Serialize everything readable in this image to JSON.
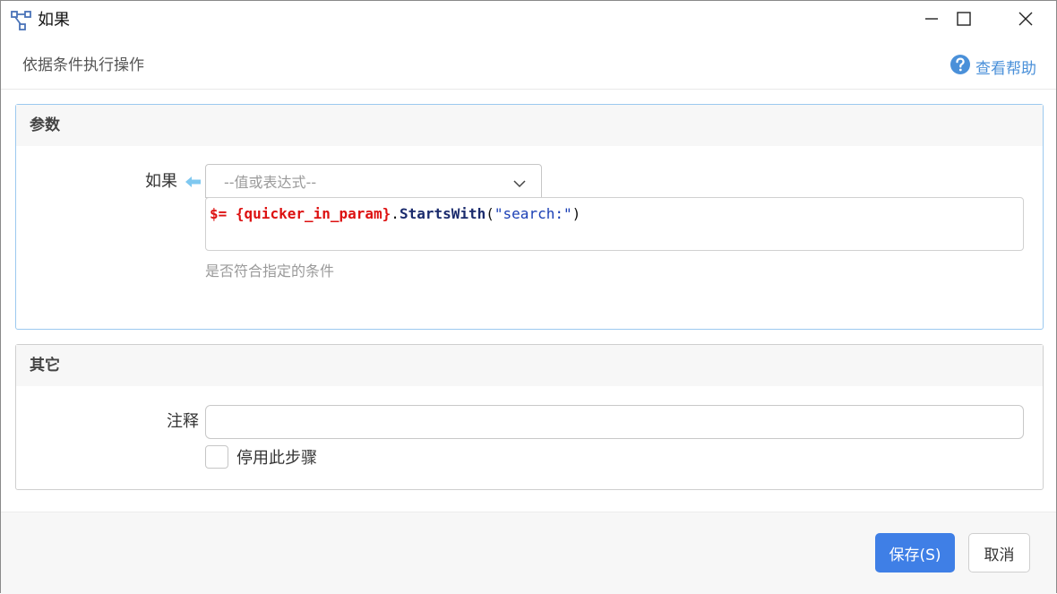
{
  "window": {
    "title": "如果",
    "controls": {
      "minimize": "minimize-icon",
      "maximize": "maximize-icon",
      "close": "close-icon"
    }
  },
  "header": {
    "subtitle": "依据条件执行操作",
    "help_label": "查看帮助"
  },
  "params_panel": {
    "title": "参数",
    "if_field": {
      "label": "如果",
      "select_placeholder": "--值或表达式--",
      "expression": {
        "prefix": "$=",
        "variable": "{quicker_in_param}",
        "dot": ".",
        "method": "StartsWith",
        "open_paren": "(",
        "string": "\"search:\"",
        "close_paren": ")"
      },
      "hint": "是否符合指定的条件"
    }
  },
  "other_panel": {
    "title": "其它",
    "note_label": "注释",
    "note_value": "",
    "disable_label": "停用此步骤",
    "disable_checked": false
  },
  "footer": {
    "save_label": "保存(S)",
    "cancel_label": "取消"
  },
  "colors": {
    "accent": "#3f7fe6",
    "help_link": "#4a90d9",
    "param_arrow": "#7fc8f0",
    "expr_variable": "#dd1111",
    "expr_string": "#1a3fb5"
  }
}
